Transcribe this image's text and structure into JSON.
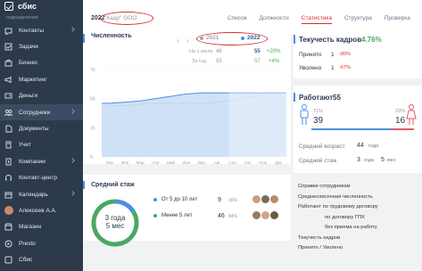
{
  "app": {
    "logo": "сбис",
    "org_subtitle": "подразделения"
  },
  "sidebar": {
    "items": [
      {
        "label": "Контакты",
        "icon": "chat-icon",
        "chevron": true
      },
      {
        "label": "Задачи",
        "icon": "tasks-icon",
        "chevron": false
      },
      {
        "label": "Бизнес",
        "icon": "briefcase-icon",
        "chevron": false
      },
      {
        "label": "Маркетинг",
        "icon": "megaphone-icon",
        "chevron": false
      },
      {
        "label": "Деньги",
        "icon": "wallet-icon",
        "chevron": false
      },
      {
        "label": "Сотрудники",
        "icon": "people-icon",
        "chevron": true,
        "active": true
      },
      {
        "label": "Документы",
        "icon": "document-icon",
        "chevron": false
      },
      {
        "label": "Учет",
        "icon": "calculator-icon",
        "chevron": false
      },
      {
        "label": "Компании",
        "icon": "building-icon",
        "chevron": true
      },
      {
        "label": "Контакт-центр",
        "icon": "headset-icon",
        "chevron": false
      },
      {
        "label": "Календарь",
        "icon": "calendar-icon",
        "chevron": true
      },
      {
        "label": "Алексеев А.А.",
        "icon": "avatar",
        "chevron": false
      },
      {
        "label": "Магазин",
        "icon": "store-icon",
        "chevron": false
      },
      {
        "label": "Presto",
        "icon": "presto-icon",
        "chevron": false
      },
      {
        "label": "Сбис",
        "icon": "sbis-icon",
        "chevron": false
      }
    ]
  },
  "header": {
    "year": "2022",
    "company": "\"Кадр\" ООО",
    "tabs": [
      "Список",
      "Должности",
      "Статистика",
      "Структура",
      "Проверка"
    ],
    "active_tab": "Статистика"
  },
  "headcount": {
    "title": "Численность",
    "legend": [
      {
        "label": "2021",
        "color": "#9aa5b1"
      },
      {
        "label": "2022",
        "color": "#4a90e2"
      }
    ],
    "rows": [
      {
        "label": "На 1 июля",
        "v2021": "46",
        "v2022": "55",
        "delta": "+20%"
      },
      {
        "label": "За год",
        "v2021": "55",
        "v2022": "57",
        "delta": "+4%"
      }
    ]
  },
  "chart_data": {
    "type": "area",
    "categories": [
      "Янв",
      "Фев",
      "Мар",
      "Апр",
      "Май",
      "Июн",
      "Июл",
      "Авг",
      "Сен",
      "Окт",
      "Ноя",
      "Дек"
    ],
    "series": [
      {
        "name": "2022",
        "values": [
          46,
          47,
          48,
          50,
          52,
          54,
          55,
          55,
          55,
          55,
          55,
          55
        ]
      },
      {
        "name": "2021",
        "values": [
          44,
          44,
          45,
          46,
          46,
          46,
          46,
          47,
          49,
          51,
          53,
          55
        ]
      }
    ],
    "yticks": [
      "75",
      "50",
      "25",
      "0"
    ],
    "ylim": [
      0,
      75
    ]
  },
  "tenure": {
    "title": "Средний стаж",
    "center_line1": "3 года",
    "center_line2": "5 мес",
    "rows": [
      {
        "label": "От 5 до 10 лет",
        "count": "9",
        "pct": "16%",
        "color": "#4a90e2"
      },
      {
        "label": "Менее 5 лет",
        "count": "46",
        "pct": "84%",
        "color": "#4aa865"
      }
    ],
    "donut": [
      16,
      84
    ]
  },
  "turnover": {
    "title": "Текучесть кадров",
    "value": "4.76%",
    "rows": [
      {
        "label": "Принято",
        "value": "1",
        "delta": "-89%"
      },
      {
        "label": "Уволено",
        "value": "1",
        "delta": "-67%"
      }
    ]
  },
  "working": {
    "title": "Работают",
    "count": "55",
    "male_pct": "71%",
    "male_count": "39",
    "female_pct": "29%",
    "female_count": "16",
    "avg_age_label": "Средний возраст",
    "avg_age_value": "44",
    "avg_age_unit": "года",
    "avg_tenure_label": "Средний стаж",
    "avg_tenure_y": "3",
    "avg_tenure_y_unit": "года",
    "avg_tenure_m": "5",
    "avg_tenure_m_unit": "мес"
  },
  "reports": [
    {
      "label": "Справки сотрудникам",
      "indent": false
    },
    {
      "label": "Среднесписочная численность",
      "indent": false
    },
    {
      "label": "Работают по трудовому договору",
      "indent": false
    },
    {
      "label": "по договору ГПХ",
      "indent": true
    },
    {
      "label": "без приема на работу",
      "indent": true
    },
    {
      "label": "Текучесть кадров",
      "indent": false
    },
    {
      "label": "Принято / Уволено",
      "indent": false
    }
  ],
  "colors": {
    "sidebar": "#2c3a4c",
    "accent": "#4a90e2",
    "brand_red": "#d0312d",
    "green": "#4aa865"
  }
}
